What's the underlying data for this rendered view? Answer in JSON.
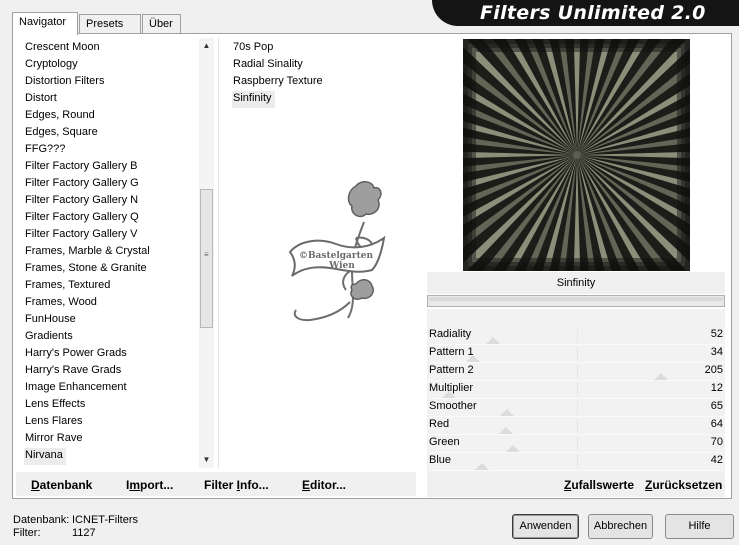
{
  "tabs": [
    {
      "label": "Navigator",
      "active": true
    },
    {
      "label": "Presets",
      "active": false
    },
    {
      "label": "Über",
      "active": false
    }
  ],
  "app_title": "Filters Unlimited 2.0",
  "categories": [
    "Crescent Moon",
    "Cryptology",
    "Distortion Filters",
    "Distort",
    "Edges, Round",
    "Edges, Square",
    "FFG???",
    "Filter Factory Gallery B",
    "Filter Factory Gallery G",
    "Filter Factory Gallery N",
    "Filter Factory Gallery Q",
    "Filter Factory Gallery V",
    "Frames, Marble & Crystal",
    "Frames, Stone & Granite",
    "Frames, Textured",
    "Frames, Wood",
    "FunHouse",
    "Gradients",
    "Harry's Power Grads",
    "Harry's Rave Grads",
    "Image Enhancement",
    "Lens Effects",
    "Lens Flares",
    "Mirror Rave",
    "Nirvana"
  ],
  "selected_category": "Nirvana",
  "filters": [
    "70s Pop",
    "Radial Sinality",
    "Raspberry Texture",
    "Sinfinity"
  ],
  "selected_filter": "Sinfinity",
  "watermark_text": [
    "©Bastelgarten",
    "Wien"
  ],
  "preview_filter_name": "Sinfinity",
  "parameters": [
    {
      "label": "Radiality",
      "value": "52",
      "fraction": 0.204
    },
    {
      "label": "Pattern 1",
      "value": "34",
      "fraction": 0.133
    },
    {
      "label": "Pattern 2",
      "value": "205",
      "fraction": 0.804
    },
    {
      "label": "Multiplier",
      "value": "12",
      "fraction": 0.047
    },
    {
      "label": "Smoother",
      "value": "65",
      "fraction": 0.255
    },
    {
      "label": "Red",
      "value": "64",
      "fraction": 0.251
    },
    {
      "label": "Green",
      "value": "70",
      "fraction": 0.275
    },
    {
      "label": "Blue",
      "value": "42",
      "fraction": 0.165
    }
  ],
  "left_buttons": {
    "database": {
      "u": "D",
      "rest": "atenbank"
    },
    "import": {
      "pre": "I",
      "u": "m",
      "rest": "port..."
    },
    "filter_info": {
      "pre": "Filter ",
      "u": "I",
      "rest": "nfo..."
    },
    "editor": {
      "u": "E",
      "rest": "ditor..."
    }
  },
  "right_buttons": {
    "randomize": {
      "u": "Z",
      "rest": "ufallswerte"
    },
    "reset": {
      "u": "Z",
      "rest": "urücksetzen"
    }
  },
  "status": {
    "database_label": "Datenbank:",
    "database_value": "ICNET-Filters",
    "filter_label": "Filter:",
    "filter_value": "1127"
  },
  "dialog_buttons": {
    "apply": "Anwenden",
    "cancel": "Abbrechen",
    "help": "Hilfe"
  },
  "colors": {
    "preview_dark": "#1c1d18",
    "preview_light": "#9ea38c",
    "banner": "#141414"
  }
}
